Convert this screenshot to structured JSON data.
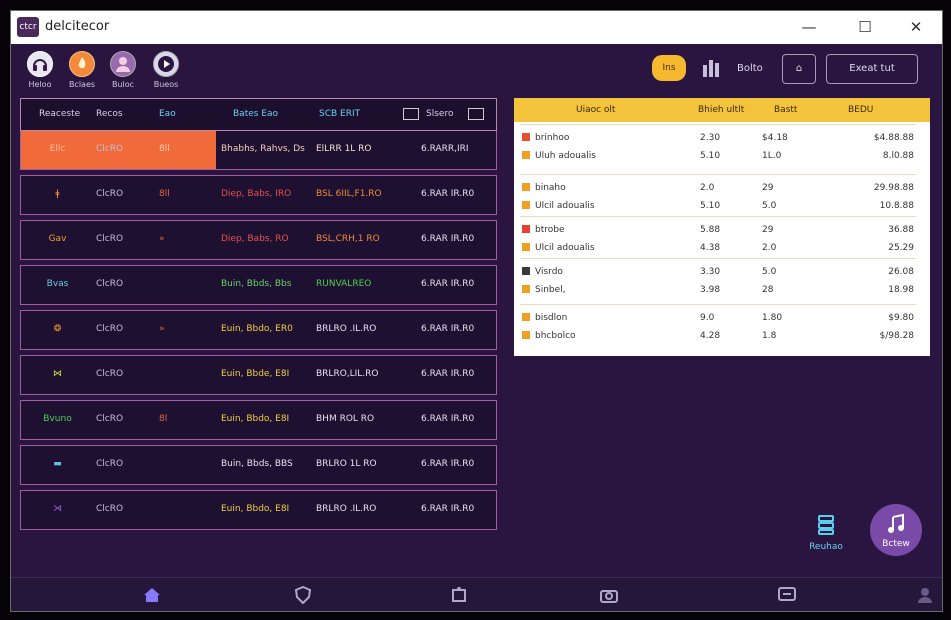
{
  "window": {
    "title": "delcitecor",
    "logo_text": "ctcr",
    "minimize": "—",
    "maximize": "☐",
    "close": "✕"
  },
  "toolbar": {
    "tools": [
      {
        "label": "Heloo",
        "icon": "headset-icon"
      },
      {
        "label": "Bclaes",
        "icon": "flame-icon"
      },
      {
        "label": "Buloc",
        "icon": "person-icon"
      },
      {
        "label": "Bueos",
        "icon": "play-icon"
      }
    ],
    "badge_text": "Ins",
    "stats_text": "Bolto",
    "chip_text": "⌂",
    "exit_label": "Exeat tut"
  },
  "table": {
    "headers": [
      "Reaceste",
      "Recos",
      "Eao",
      "Bates Eao",
      "SCB ERIT",
      "Slsero"
    ],
    "rows": [
      {
        "icon_text": "Ellc",
        "name": "ClcRO",
        "code": "8ll",
        "date": "Bhabhs, Rahvs, Ds",
        "amount": "ElLRR 1L RO",
        "balance": "6.RARR,IRI",
        "date_color": "#f4d0b8",
        "amount_color": "#f6e0d0",
        "icon_color": "#f7c0a0"
      },
      {
        "icon_text": "ǂ",
        "name": "ClcRO",
        "code": "8ll",
        "date": "Diep, Babs, IRO",
        "amount": "BSL 6IIL,F1.RO",
        "balance": "6.RAR IR.R0",
        "date_color": "#e85050",
        "amount_color": "#f08a3a",
        "icon_color": "#f0a030"
      },
      {
        "icon_text": "Gav",
        "name": "ClcRO",
        "code": "»",
        "date": "Diep, Babs, RO",
        "amount": "BSL,CRH,1 RO",
        "balance": "6.RAR IR.R0",
        "date_color": "#e85050",
        "amount_color": "#f08a3a",
        "icon_color": "#f0a030"
      },
      {
        "icon_text": "Bvas",
        "name": "ClcRO",
        "code": "",
        "date": "Buin, Bbds, Bbs",
        "amount": "RUNVALREO",
        "balance": "6.RAR IR.R0",
        "date_color": "#6ad06a",
        "amount_color": "#4ed04e",
        "icon_color": "#6ad0e0"
      },
      {
        "icon_text": "❂",
        "name": "ClcRO",
        "code": "»",
        "date": "Euin, Bbdo, ER0",
        "amount": "BRLRO .IL.RO",
        "balance": "6.RAR IR.R0",
        "date_color": "#f0d040",
        "amount_color": "#e8e0f0",
        "icon_color": "#f0a030"
      },
      {
        "icon_text": "⋈",
        "name": "ClcRO",
        "code": "",
        "date": "Euin, Bbde, E8I",
        "amount": "BRLRO,LIL.RO",
        "balance": "6.RAR IR.R0",
        "date_color": "#f0d040",
        "amount_color": "#e8e0f0",
        "icon_color": "#d0e040"
      },
      {
        "icon_text": "Bvuno",
        "name": "ClcRO",
        "code": "8l",
        "date": "Euin, Bbdo, E8I",
        "amount": "BHM ROL RO",
        "balance": "6.RAR IR.R0",
        "date_color": "#f0d040",
        "amount_color": "#e8e0f0",
        "icon_color": "#4ed04e"
      },
      {
        "icon_text": "▬",
        "name": "ClcRO",
        "code": "",
        "date": "Buin, Bbds, BBS",
        "amount": "BRLRO 1L RO",
        "balance": "6.RAR IR.R0",
        "date_color": "#e8e0f0",
        "amount_color": "#e8e0f0",
        "icon_color": "#60c0e0"
      },
      {
        "icon_text": "⋊",
        "name": "ClcRO",
        "code": "",
        "date": "Euin, Bbdo, E8I",
        "amount": "BRLRO .IL.RO",
        "balance": "6.RAR IR.R0",
        "date_color": "#f0d040",
        "amount_color": "#e8e0f0",
        "icon_color": "#a060d0"
      }
    ]
  },
  "card": {
    "headers": [
      "Uiaoc olt",
      "Bhieh ultlt",
      "Bastt",
      "BEDU"
    ],
    "groups": [
      {
        "items": [
          {
            "label": "brinhoo",
            "v1": "2.30",
            "v2": "$4.18",
            "total": "$4.88.88",
            "dot": "#e85030"
          },
          {
            "label": "Uluh adoualis",
            "v1": "5.10",
            "v2": "1L.0",
            "total": "8.l0.88",
            "dot": "#f0a020"
          }
        ]
      },
      {
        "items": [
          {
            "label": "binaho",
            "v1": "2.0",
            "v2": "29",
            "total": "29.98.88",
            "dot": "#f0a020"
          },
          {
            "label": "Ulcil adoualis",
            "v1": "5.10",
            "v2": "5.0",
            "total": "10.8.88",
            "dot": "#f0a020"
          }
        ]
      },
      {
        "items": [
          {
            "label": "btrobe",
            "v1": "5.88",
            "v2": "29",
            "total": "36.88",
            "dot": "#e84030"
          },
          {
            "label": "Ulcil adoualis",
            "v1": "4.38",
            "v2": "2.0",
            "total": "25.29",
            "dot": "#f0a020"
          }
        ]
      },
      {
        "items": [
          {
            "label": "Visrdo",
            "v1": "3.30",
            "v2": "5.0",
            "total": "26.08",
            "dot": "#3a3a3a"
          },
          {
            "label": "Sinbel,",
            "v1": "3.98",
            "v2": "28",
            "total": "18.98",
            "dot": "#f0a020"
          }
        ]
      },
      {
        "items": [
          {
            "label": "bisdlon",
            "v1": "9.0",
            "v2": "1.80",
            "total": "$9.80",
            "dot": "#f0a020"
          },
          {
            "label": "bhcbolco",
            "v1": "4.28",
            "v2": "1.8",
            "total": "$/98.28",
            "dot": "#f0a020"
          }
        ]
      }
    ]
  },
  "side": {
    "label": "Reuhao"
  },
  "fab": {
    "label": "Bctew"
  },
  "bottomnav": [
    "home-icon",
    "shield-icon",
    "puzzle-icon",
    "camera-icon",
    "chat-icon",
    "person-icon"
  ],
  "colors": {
    "window_bg": "#2a1540",
    "accent_orange": "#f06a3a",
    "card_header": "#f3c33b",
    "fab": "#7a4aa8"
  }
}
